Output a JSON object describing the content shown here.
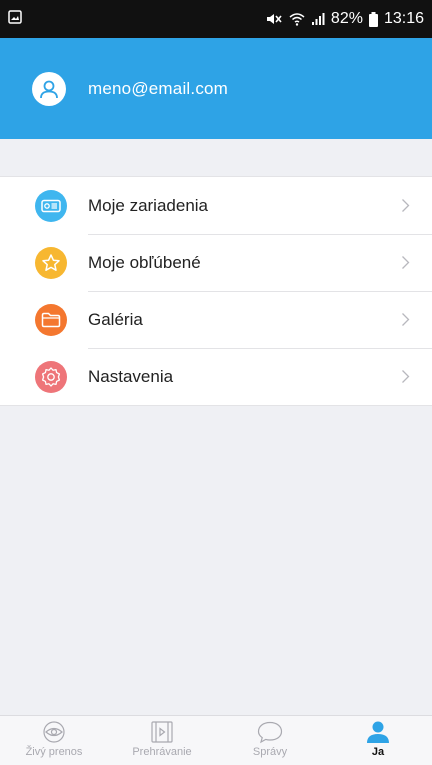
{
  "status_bar": {
    "battery": "82%",
    "time": "13:16"
  },
  "header": {
    "email": "meno@email.com"
  },
  "menu": [
    {
      "label": "Moje zariadenia",
      "icon": "device-icon",
      "color": "#3fb6ef"
    },
    {
      "label": "Moje obľúbené",
      "icon": "star-icon",
      "color": "#f7b731"
    },
    {
      "label": "Galéria",
      "icon": "folder-icon",
      "color": "#f4772f"
    },
    {
      "label": "Nastavenia",
      "icon": "gear-icon",
      "color": "#ee7579"
    }
  ],
  "tabbar": {
    "tabs": [
      {
        "label": "Živý prenos",
        "icon": "eye-icon",
        "active": false
      },
      {
        "label": "Prehrávanie",
        "icon": "playback-icon",
        "active": false
      },
      {
        "label": "Správy",
        "icon": "chat-bubble-icon",
        "active": false
      },
      {
        "label": "Ja",
        "icon": "person-icon",
        "active": true
      }
    ],
    "active_color": "#2ea3e6",
    "inactive_color": "#a9a9b0"
  },
  "colors": {
    "header_bg": "#2ea3e6",
    "page_bg": "#eff0f4"
  }
}
